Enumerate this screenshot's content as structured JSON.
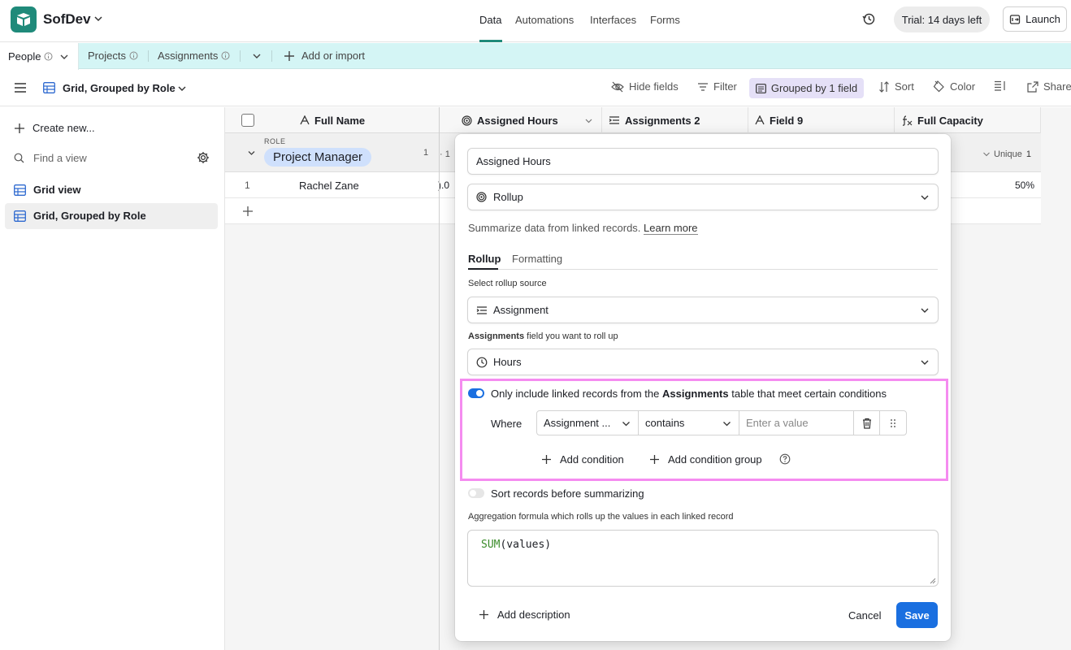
{
  "top_bar": {
    "base_name": "SofDev",
    "nav_tabs": [
      "Data",
      "Automations",
      "Interfaces",
      "Forms"
    ],
    "active_tab": "Data",
    "trial_badge": "Trial: 14 days left",
    "launch_label": "Launch",
    "accent_color": "#1f8a7a"
  },
  "table_tabs": {
    "tabs": [
      "People",
      "Projects",
      "Assignments"
    ],
    "active": "People",
    "add_label": "Add or import"
  },
  "view_bar": {
    "view_name": "Grid, Grouped by Role",
    "hide_fields": "Hide fields",
    "filter": "Filter",
    "grouped": "Grouped by 1 field",
    "sort": "Sort",
    "color": "Color",
    "share": "Share"
  },
  "sidebar": {
    "create_new": "Create new...",
    "find_placeholder": "Find a view",
    "views": [
      "Grid view",
      "Grid, Grouped by Role"
    ],
    "active_view": "Grid, Grouped by Role"
  },
  "grid": {
    "columns": [
      "Full Name",
      "Assigned Hours",
      "Assignments 2",
      "Field 9",
      "Full Capacity"
    ],
    "group": {
      "label": "ROLE",
      "value": "Project Manager",
      "count": "1",
      "partial_count": "· 1",
      "unique_label": "Unique",
      "unique_count": "1"
    },
    "rows": [
      {
        "num": "1",
        "full_name": "Rachel Zane",
        "hours_partial": ").0",
        "capacity": "50%"
      }
    ]
  },
  "field_editor": {
    "field_name": "Assigned Hours",
    "field_type": "Rollup",
    "description": "Summarize data from linked records.",
    "learn_more": "Learn more",
    "tabs": [
      "Rollup",
      "Formatting"
    ],
    "active_tab": "Rollup",
    "rollup_source_label": "Select rollup source",
    "rollup_source_value": "Assignment",
    "rollup_field_label_bold": "Assignments",
    "rollup_field_label_rest": " field you want to roll up",
    "rollup_field_value": "Hours",
    "condition_toggle_on": true,
    "condition_text_before": "Only include linked records from the ",
    "condition_text_bold": "Assignments",
    "condition_text_after": " table that meet certain conditions",
    "where_label": "Where",
    "condition_field": "Assignment ...",
    "condition_operator": "contains",
    "condition_value_placeholder": "Enter a value",
    "add_condition": "Add condition",
    "add_condition_group": "Add condition group",
    "sort_toggle_on": false,
    "sort_label": "Sort records before summarizing",
    "aggregation_label": "Aggregation formula which rolls up the values in each linked record",
    "formula_fn": "SUM",
    "formula_args": "(values)",
    "add_description": "Add description",
    "cancel": "Cancel",
    "save": "Save",
    "primary_color": "#1a6fe0",
    "highlight_color": "#f58cf0"
  }
}
